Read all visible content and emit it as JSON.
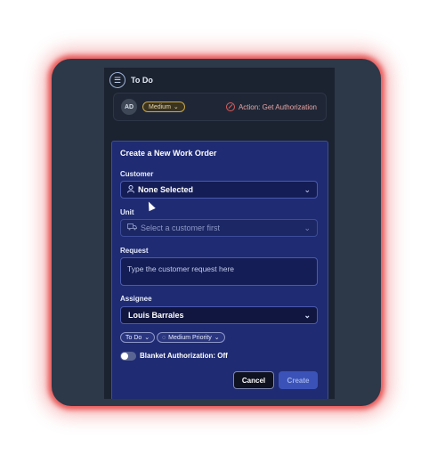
{
  "header": {
    "title": "To Do",
    "icon": "list-icon"
  },
  "task_card": {
    "avatar": "AD",
    "priority_label": "Medium",
    "action_text": "Action: Get Authorization"
  },
  "form": {
    "title": "Create a New Work Order",
    "customer": {
      "label": "Customer",
      "value": "None Selected"
    },
    "unit": {
      "label": "Unit",
      "placeholder": "Select a customer first"
    },
    "request": {
      "label": "Request",
      "placeholder": "Type the customer request here"
    },
    "assignee": {
      "label": "Assignee",
      "value": "Louis Barrales"
    },
    "chips": {
      "status": "To Do",
      "priority": "Medium Priority"
    },
    "toggle": {
      "label": "Blanket Authorization:",
      "state": "Off",
      "on": false
    },
    "buttons": {
      "cancel": "Cancel",
      "create": "Create"
    }
  },
  "colors": {
    "glow": "#e85a5a",
    "form_bg": "#1f2b72",
    "accent": "#3b53b8"
  }
}
